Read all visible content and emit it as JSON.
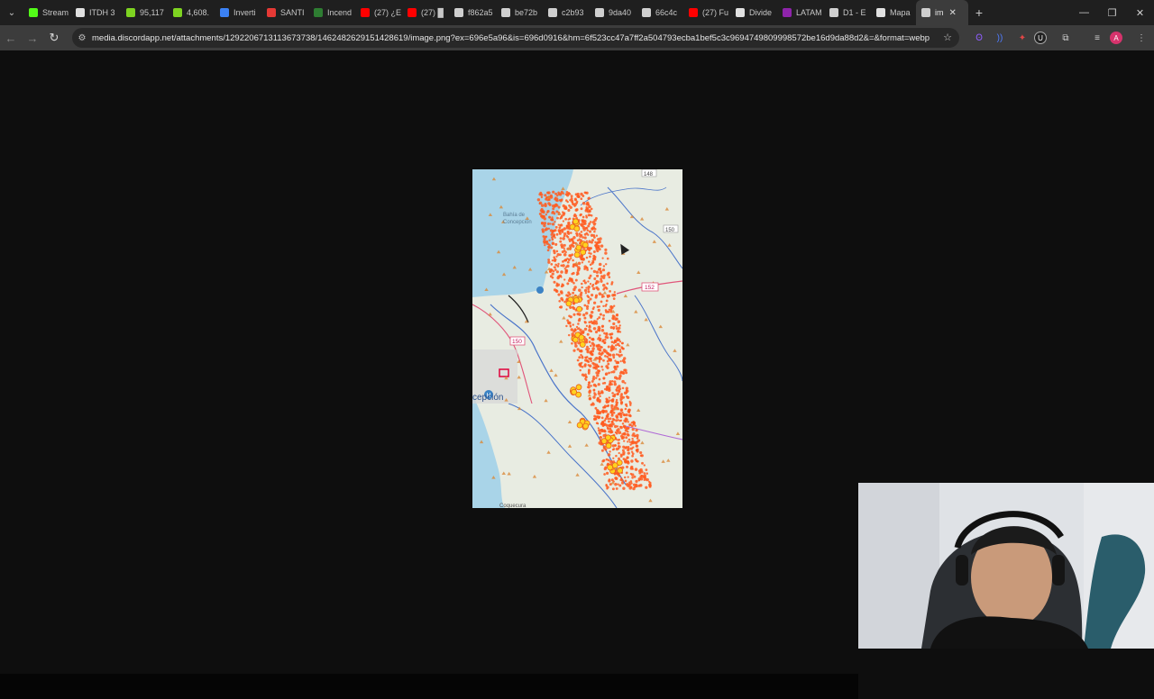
{
  "tabs": [
    {
      "label": "Stream",
      "icon": "kick-icon",
      "color": "#53fc18"
    },
    {
      "label": "ITDH 3",
      "icon": "tradingview-icon",
      "color": "#e0e0e0"
    },
    {
      "label": "95,117",
      "icon": "leaf-icon",
      "color": "#7ed321"
    },
    {
      "label": "4,608.",
      "icon": "leaf-icon",
      "color": "#7ed321"
    },
    {
      "label": "Inverti",
      "icon": "coin-icon",
      "color": "#3b82f6"
    },
    {
      "label": "SANTI",
      "icon": "bolt-icon",
      "color": "#e53935"
    },
    {
      "label": "Incend",
      "icon": "map-icon",
      "color": "#2e7d32"
    },
    {
      "label": "(27) ¿E",
      "icon": "youtube-icon",
      "color": "#ff0000"
    },
    {
      "label": "(27) █",
      "icon": "youtube-icon",
      "color": "#ff0000"
    },
    {
      "label": "f862a5",
      "icon": "globe-icon",
      "color": "#cfcfcf"
    },
    {
      "label": "be72b",
      "icon": "globe-icon",
      "color": "#cfcfcf"
    },
    {
      "label": "c2b93",
      "icon": "globe-icon",
      "color": "#cfcfcf"
    },
    {
      "label": "9da40",
      "icon": "globe-icon",
      "color": "#cfcfcf"
    },
    {
      "label": "66c4c",
      "icon": "globe-icon",
      "color": "#cfcfcf"
    },
    {
      "label": "(27) Fu",
      "icon": "youtube-icon",
      "color": "#ff0000"
    },
    {
      "label": "Divide",
      "icon": "news-icon",
      "color": "#e0e0e0"
    },
    {
      "label": "LATAM",
      "icon": "latam-icon",
      "color": "#8e24aa"
    },
    {
      "label": "D1 - E",
      "icon": "globe-icon",
      "color": "#cfcfcf"
    },
    {
      "label": "Mapa",
      "icon": "tradingview-icon",
      "color": "#e0e0e0"
    },
    {
      "label": "im",
      "icon": "globe-icon",
      "color": "#cfcfcf",
      "active": true
    }
  ],
  "window": {
    "minimize": "—",
    "restore": "❐",
    "close": "✕"
  },
  "nav": {
    "back": "←",
    "forward": "→",
    "reload": "↻"
  },
  "address": {
    "url": "media.discordapp.net/attachments/1292206713113673738/1462482629151428619/image.png?ex=696e5a96&is=696d0916&hm=6f523cc47a7ff2a504793ecba1bef5c3c96947498099985 72be16d9da88d2&=&format=webp...",
    "url_display": "media.discordapp.net/attachments/1292206713113673738/1462482629151428619/image.png?ex=696e5a96&is=696d0916&hm=6f523cc47a7ff2a504793ecba1bef5c3c96947498099​98572be16d9da88d2&=&format=webp..."
  },
  "extensions": [
    {
      "name": "perplexity-icon",
      "glyph": "Ꙩ",
      "color": "#8b5cf6"
    },
    {
      "name": "wave-icon",
      "glyph": "))",
      "color": "#4f7cff"
    },
    {
      "name": "extension-badge-icon",
      "glyph": "✦",
      "color": "#e04646"
    },
    {
      "name": "ublock-icon",
      "glyph": "U",
      "color": "#ffffff"
    },
    {
      "name": "puzzle-icon",
      "glyph": "⧉",
      "color": "#d0d0d0"
    },
    {
      "name": "media-icon",
      "glyph": "≡",
      "color": "#d0d0d0"
    },
    {
      "name": "profile-avatar",
      "glyph": "A",
      "color": "#ffffff"
    },
    {
      "name": "menu-icon",
      "glyph": "⋮",
      "color": "#d0d0d0"
    }
  ],
  "map": {
    "labels": {
      "bay": "Bahía de Concepción",
      "city": "cepción",
      "road1": "152",
      "road2": "150",
      "road3": "148",
      "road4": "150",
      "bottom": "Coquecura"
    },
    "fire_color": "#ff5a1f",
    "water_color": "#a9d4e8"
  }
}
